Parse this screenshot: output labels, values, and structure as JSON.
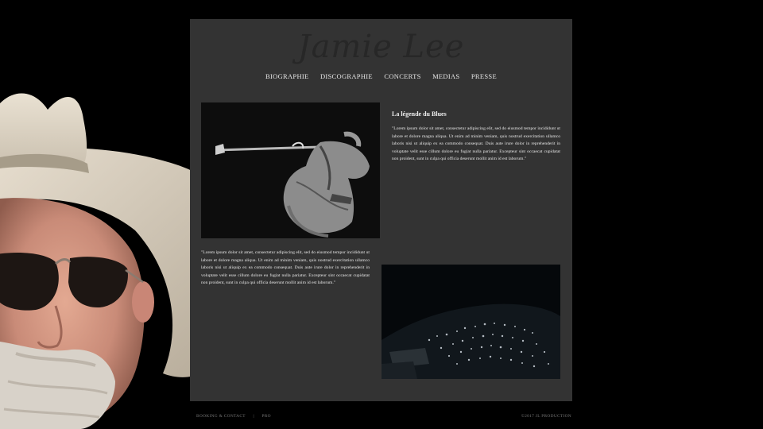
{
  "site": {
    "logo": "Jamie Lee"
  },
  "nav": [
    {
      "label": "BIOGRAPHIE"
    },
    {
      "label": "DISCOGRAPHIE"
    },
    {
      "label": "CONCERTS"
    },
    {
      "label": "MEDIAS"
    },
    {
      "label": "PRESSE"
    }
  ],
  "content": {
    "heading": "La légende du Blues",
    "paragraph1": "\"Lorem ipsum dolor sit amet, consectetur adipiscing elit, sed do eiusmod tempor incididunt ut labore et dolore magna aliqua. Ut enim ad minim veniam, quis nostrud exercitation ullamco laboris nisi ut aliquip ex ea commodo consequat. Duis aute irure dolor in reprehenderit in voluptate velit esse cillum dolore eu fugiat nulla pariatur. Excepteur sint occaecat cupidatat non proident, sunt in culpa qui officia deserunt mollit anim id est laborum.\"",
    "paragraph2": "\"Lorem ipsum dolor sit amet, consectetur adipiscing elit, sed do eiusmod tempor incididunt ut labore et dolore magna aliqua. Ut enim ad minim veniam, quis nostrud exercitation ullamco laboris nisi ut aliquip ex ea commodo consequat. Duis aute irure dolor in reprehenderit in voluptate velit esse cillum dolore eu fugiat nulla pariatur. Excepteur sint occaecat cupidatat non proident, sunt in culpa qui officia deserunt mollit anim id est laborum.\""
  },
  "footer": {
    "booking": "BOOKING & CONTACT",
    "separator": "|",
    "pro": "PRO",
    "copyright": "©2017 JL PRODUCTION"
  },
  "colors": {
    "page_bg": "#000000",
    "panel_bg": "#333333",
    "logo": "#272727",
    "text": "#e6e6e6",
    "footer_text": "#777777"
  }
}
